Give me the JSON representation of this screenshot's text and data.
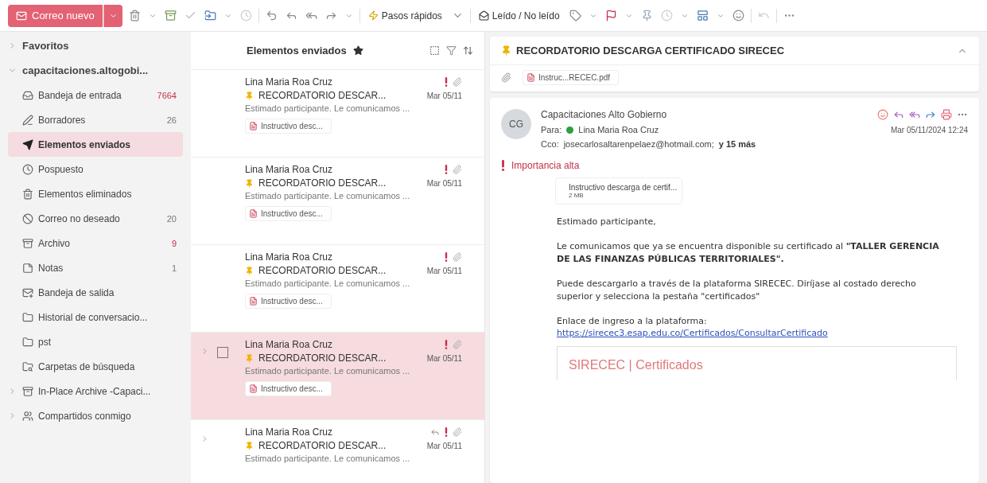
{
  "toolbar": {
    "new_mail": "Correo nuevo",
    "quick_steps": "Pasos rápidos",
    "read_unread": "Leído / No leído"
  },
  "sidebar": [
    {
      "label": "Favoritos",
      "kind": "group",
      "expanded": false
    },
    {
      "label": "capacitaciones.altogobi...",
      "kind": "group",
      "expanded": true,
      "children": [
        {
          "label": "Bandeja de entrada",
          "count": "7664",
          "unread": true,
          "selected": false
        },
        {
          "label": "Borradores",
          "count": "26",
          "unread": false,
          "selected": false
        },
        {
          "label": "Elementos enviados",
          "selected": true
        },
        {
          "label": "Pospuesto",
          "selected": false
        },
        {
          "label": "Elementos eliminados",
          "selected": false
        },
        {
          "label": "Correo no deseado",
          "count": "20",
          "unread": false,
          "selected": false
        },
        {
          "label": "Archivo",
          "count": "9",
          "unread": true,
          "selected": false
        },
        {
          "label": "Notas",
          "count": "1",
          "unread": false,
          "selected": false
        },
        {
          "label": "Bandeja de salida",
          "selected": false
        },
        {
          "label": "Historial de conversacio...",
          "selected": false
        },
        {
          "label": "pst",
          "selected": false
        },
        {
          "label": "Carpetas de búsqueda",
          "selected": false
        }
      ]
    },
    {
      "label": "In-Place Archive -Capaci...",
      "kind": "folder",
      "expanded": false
    },
    {
      "label": "Compartidos conmigo",
      "kind": "folder",
      "expanded": false
    }
  ],
  "list": {
    "title": "Elementos enviados",
    "items": [
      {
        "sender": "Lina Maria Roa Cruz",
        "subject": "RECORDATORIO DESCAR...",
        "date": "Mar 05/11",
        "preview": "Estimado participante. Le comunicamos ...",
        "attachment": "Instructivo desc...",
        "selected": false,
        "expandable": false,
        "replied": false
      },
      {
        "sender": "Lina Maria Roa Cruz",
        "subject": "RECORDATORIO DESCAR...",
        "date": "Mar 05/11",
        "preview": "Estimado participante. Le comunicamos ...",
        "attachment": "Instructivo desc...",
        "selected": false,
        "expandable": false,
        "replied": false
      },
      {
        "sender": "Lina Maria Roa Cruz",
        "subject": "RECORDATORIO DESCAR...",
        "date": "Mar 05/11",
        "preview": "Estimado participante. Le comunicamos ...",
        "attachment": "Instructivo desc...",
        "selected": false,
        "expandable": false,
        "replied": false
      },
      {
        "sender": "Lina Maria Roa Cruz",
        "subject": "RECORDATORIO DESCAR...",
        "date": "Mar 05/11",
        "preview": "Estimado participante. Le comunicamos ...",
        "attachment": "Instructivo desc...",
        "selected": true,
        "expandable": true,
        "replied": false
      },
      {
        "sender": "Lina Maria Roa Cruz",
        "subject": "RECORDATORIO DESCAR...",
        "date": "Mar 05/11",
        "preview": "Estimado participante. Le comunicamos ...",
        "selected": false,
        "expandable": true,
        "replied": true
      }
    ]
  },
  "reading": {
    "subject": "RECORDATORIO DESCARGA CERTIFICADO SIRECEC",
    "top_attachment": "Instruc...RECEC.pdf",
    "message": {
      "avatar": "CG",
      "sender": "Capacitaciones Alto Gobierno",
      "to_label": "Para:",
      "to": "Lina Maria Roa Cruz",
      "date": "Mar 05/11/2024 12:24",
      "cc_label": "Cco:",
      "cc": "josecarlosaltarenpelaez@hotmail.com;",
      "cc_more": "y 15 más",
      "importance": "Importancia alta",
      "attachment": {
        "name": "Instructivo descarga de certif...",
        "size": "2 MB"
      },
      "body": [
        "Estimado participante,",
        "Le comunicamos que ya se encuentra disponible su certificado al **\"TALLER GERENCIA DE LAS FINANZAS PÚBLICAS TERRITORIALES\".**",
        "Puede descargarlo a través de la plataforma SIRECEC. Diríjase al costado derecho superior y selecciona la pestaña \"certificados\"",
        "Enlace de ingreso a la plataforma:"
      ],
      "link": "https://sirecec3.esap.edu.co/Certificados/ConsultarCertificado",
      "card_title": "SIRECEC | Certificados"
    }
  }
}
